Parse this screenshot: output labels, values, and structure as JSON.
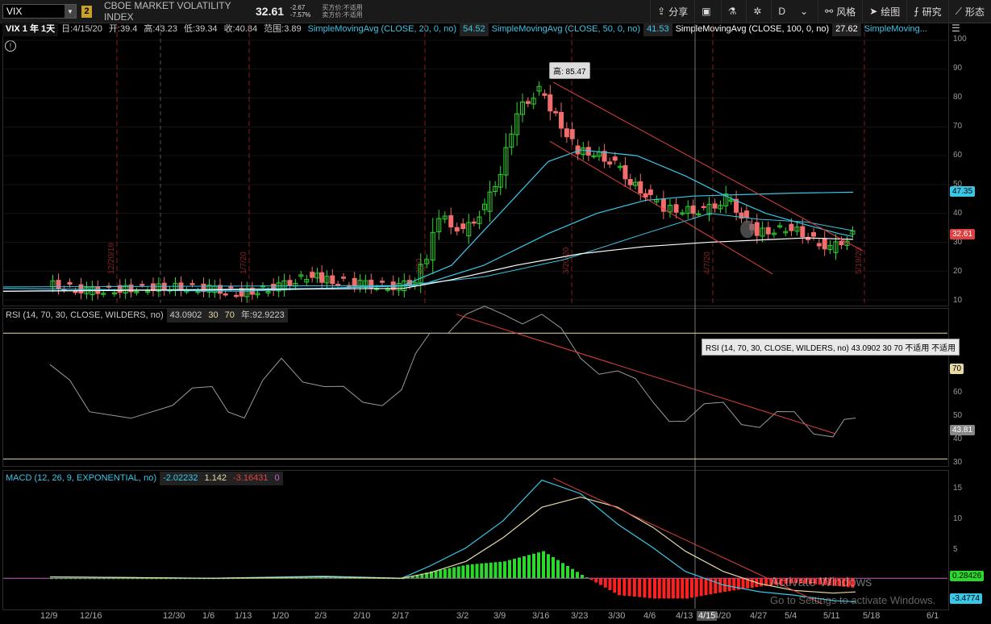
{
  "toolbar": {
    "symbol": "VIX",
    "link_badge": "2",
    "instrument_name": "CBOE MARKET VOLATILITY INDEX",
    "last_price": "32.61",
    "net_change": "-2.67",
    "pct_change": "-7.57%",
    "bid_label": "买方价:不适用",
    "ask_label": "卖方价:不适用",
    "buttons": [
      {
        "label": "分享",
        "icon": "share-icon"
      },
      {
        "label": "",
        "icon": "layout-icon"
      },
      {
        "label": "",
        "icon": "flask-icon"
      },
      {
        "label": "",
        "icon": "gear-icon"
      },
      {
        "label": "D",
        "icon": ""
      },
      {
        "label": "风格",
        "icon": "style-icon"
      },
      {
        "label": "绘图",
        "icon": "cursor-icon"
      },
      {
        "label": "研究",
        "icon": "study-icon"
      },
      {
        "label": "形态",
        "icon": "pattern-icon"
      }
    ]
  },
  "price_header": {
    "symbol_period": "VIX 1 年 1天",
    "ohlc": [
      "日:4/15/20",
      "开:39.4",
      "高:43.23",
      "低:39.34",
      "收:40.84",
      "范围:3.89"
    ],
    "studies": [
      {
        "label": "SimpleMovingAvg (CLOSE, 20, 0, no)",
        "value": "54.52",
        "color": "#39c7e8"
      },
      {
        "label": "SimpleMovingAvg (CLOSE, 50, 0, no)",
        "value": "41.53",
        "color": "#39c7e8"
      },
      {
        "label": "SimpleMovingAvg (CLOSE, 100, 0, no)",
        "value": "27.62",
        "color": "#ffffff"
      },
      {
        "label": "SimpleMoving...",
        "value": "",
        "color": "#39c7e8"
      }
    ]
  },
  "high_label": "高: 85.47",
  "price_axis": {
    "ticks": [
      "100",
      "90",
      "80",
      "70",
      "60",
      "50",
      "40",
      "30",
      "20",
      "10"
    ],
    "tag_sma": "47.35",
    "tag_last": "32.61"
  },
  "event_labels": [
    "12/20/19",
    "1/7/20",
    "2/20",
    "3/20/20",
    "4/7/20",
    "5/19/20"
  ],
  "rsi": {
    "header": [
      "RSI (14, 70, 30, CLOSE, WILDERS, no)",
      "43.0902",
      "30",
      "70",
      "年:92.9223"
    ],
    "tooltip": "RSI (14, 70, 30, CLOSE, WILDERS, no) 43.0902 30 70 不适用 不适用",
    "ticks": [
      "70",
      "60",
      "50",
      "40",
      "30"
    ],
    "tag_70": "70",
    "tag_value": "43.81"
  },
  "macd": {
    "header": [
      "MACD (12, 26, 9, EXPONENTIAL, no)",
      "-2.02232",
      "1.142",
      "-3.16431",
      "0"
    ],
    "ticks": [
      "15",
      "10",
      "5",
      "0"
    ],
    "tag_zero": "0.28426",
    "tag_value": "-3.4774"
  },
  "x_axis": [
    "12/9",
    "12/16",
    "12/30",
    "1/6",
    "1/13",
    "1/20",
    "2/3",
    "2/10",
    "2/17",
    "3/2",
    "3/9",
    "3/16",
    "3/23",
    "3/30",
    "4/6",
    "4/13",
    "4/15",
    "4/20",
    "4/27",
    "5/4",
    "5/11",
    "5/18",
    "6/1"
  ],
  "watermark": {
    "line1": "Activate Windows",
    "line2": "Go to Settings to activate Windows."
  },
  "colors": {
    "up": "#2bd92b",
    "down": "#f26d6d",
    "sma_cyan": "#39c7e8",
    "sma_white": "#ffffff",
    "trend": "#e04040",
    "macd_signal": "#e6d9a6"
  },
  "chart_data": [
    {
      "type": "candlestick",
      "title": "VIX 1 年 1天",
      "ylim": [
        10,
        100
      ],
      "close_points": [
        {
          "x": "12/9",
          "y": 15.7
        },
        {
          "x": "12/16",
          "y": 13.0
        },
        {
          "x": "12/30",
          "y": 14.5
        },
        {
          "x": "1/6",
          "y": 13.8
        },
        {
          "x": "1/13",
          "y": 12.3
        },
        {
          "x": "1/20",
          "y": 14.6
        },
        {
          "x": "1/31",
          "y": 18.8
        },
        {
          "x": "2/3",
          "y": 17.1
        },
        {
          "x": "2/10",
          "y": 15.5
        },
        {
          "x": "2/17",
          "y": 14.4
        },
        {
          "x": "2/21",
          "y": 17.1
        },
        {
          "x": "2/24",
          "y": 25.0
        },
        {
          "x": "2/27",
          "y": 39.2
        },
        {
          "x": "3/2",
          "y": 33.4
        },
        {
          "x": "3/6",
          "y": 41.9
        },
        {
          "x": "3/9",
          "y": 54.5
        },
        {
          "x": "3/12",
          "y": 75.5
        },
        {
          "x": "3/16",
          "y": 82.7
        },
        {
          "x": "3/18",
          "y": 76.5
        },
        {
          "x": "3/23",
          "y": 61.6
        },
        {
          "x": "3/26",
          "y": 61.0
        },
        {
          "x": "3/30",
          "y": 57.1
        },
        {
          "x": "4/2",
          "y": 50.9
        },
        {
          "x": "4/6",
          "y": 45.2
        },
        {
          "x": "4/9",
          "y": 41.7
        },
        {
          "x": "4/13",
          "y": 41.2
        },
        {
          "x": "4/15",
          "y": 40.8
        },
        {
          "x": "4/20",
          "y": 43.8
        },
        {
          "x": "4/21",
          "y": 45.4
        },
        {
          "x": "4/27",
          "y": 33.3
        },
        {
          "x": "5/4",
          "y": 35.0
        },
        {
          "x": "5/11",
          "y": 27.6
        },
        {
          "x": "5/15",
          "y": 32.6
        }
      ],
      "high": 85.47,
      "last": 32.61
    },
    {
      "type": "line",
      "title": "RSI (14, 70, 30, CLOSE, WILDERS, no)",
      "ylim": [
        28,
        78
      ],
      "x": [
        "12/9",
        "12/16",
        "12/30",
        "1/6",
        "1/13",
        "1/20",
        "2/3",
        "2/10",
        "2/17",
        "2/24",
        "3/2",
        "3/9",
        "3/16",
        "3/23",
        "3/30",
        "4/6",
        "4/13",
        "4/20",
        "4/27",
        "5/4",
        "5/11",
        "5/15"
      ],
      "values": [
        60,
        45,
        47,
        53,
        43,
        62,
        53,
        48,
        52,
        70,
        91,
        80,
        78,
        62,
        58,
        48,
        42,
        48,
        40,
        45,
        37,
        43
      ]
    },
    {
      "type": "line",
      "title": "MACD (12, 26, 9, EXPONENTIAL, no)",
      "ylim": [
        -4.5,
        16
      ],
      "x": [
        "12/9",
        "1/6",
        "2/3",
        "2/17",
        "2/24",
        "3/2",
        "3/9",
        "3/16",
        "3/23",
        "3/30",
        "4/6",
        "4/13",
        "4/20",
        "4/27",
        "5/4",
        "5/11",
        "5/15"
      ],
      "series": [
        {
          "name": "MACD",
          "values": [
            0.2,
            0.0,
            0.3,
            0.0,
            1.8,
            4.5,
            8.5,
            14.5,
            12.5,
            8.0,
            4.5,
            1.0,
            -1.0,
            -2.0,
            -2.5,
            -3.3,
            -3.48
          ]
        },
        {
          "name": "Signal",
          "values": [
            0.2,
            0.0,
            0.2,
            0.0,
            0.8,
            2.5,
            6.0,
            10.5,
            12.0,
            10.5,
            7.5,
            4.0,
            1.0,
            -0.8,
            -1.8,
            -2.2,
            -2.02
          ]
        }
      ]
    }
  ]
}
